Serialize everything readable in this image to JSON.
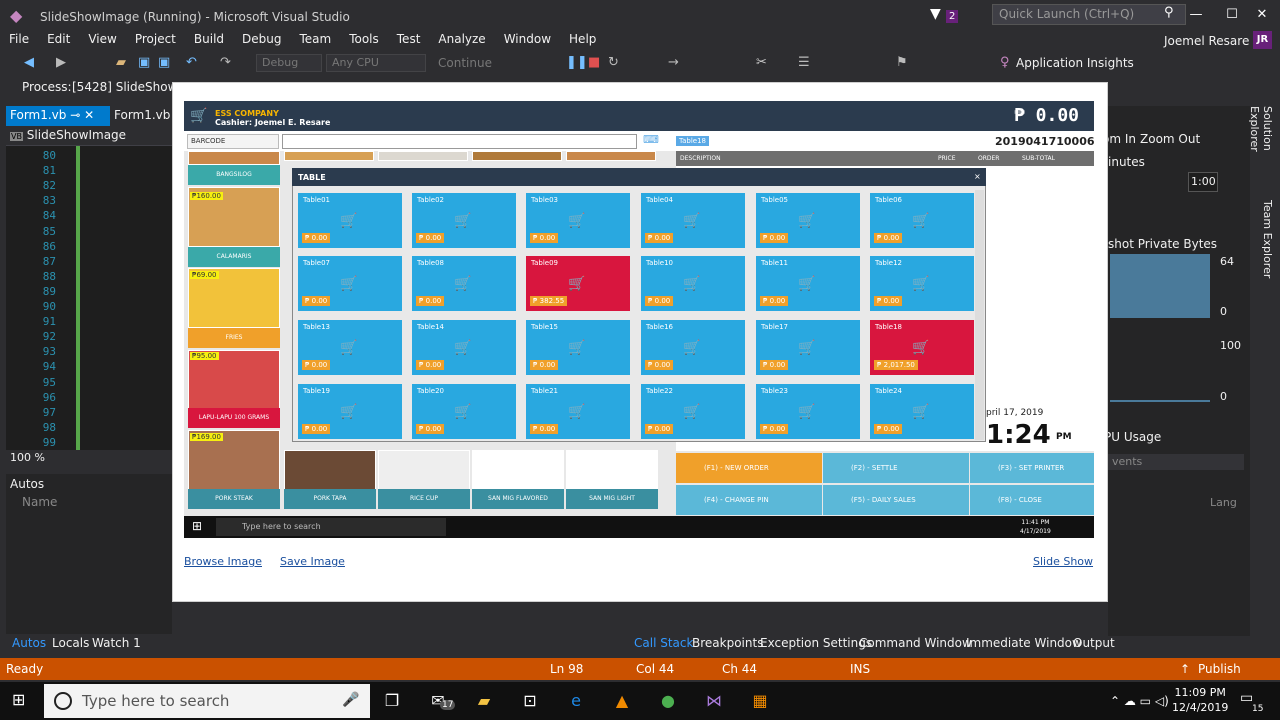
{
  "titlebar": {
    "title": "SlideShowImage (Running) - Microsoft Visual Studio",
    "notif_count": "2",
    "quick_launch": "Quick Launch (Ctrl+Q)",
    "user": "Joemel Resare",
    "avatar": "JR"
  },
  "menu": [
    "File",
    "Edit",
    "View",
    "Project",
    "Build",
    "Debug",
    "Team",
    "Tools",
    "Test",
    "Analyze",
    "Window",
    "Help"
  ],
  "toolbar": {
    "config": "Debug",
    "platform": "Any CPU",
    "continue": "Continue",
    "app_insights": "Application Insights"
  },
  "process": {
    "label": "Process:",
    "value": "[5428] SlideShowIma"
  },
  "editor": {
    "tab1": "Form1.vb",
    "tab2": "Form1.vb [D",
    "class": "SlideShowImage",
    "lines": [
      "80",
      "81",
      "82",
      "83",
      "84",
      "85",
      "86",
      "87",
      "88",
      "89",
      "90",
      "91",
      "92",
      "93",
      "94",
      "95",
      "96",
      "97",
      "98",
      "99"
    ],
    "zoom": "100 %"
  },
  "autos": {
    "title": "Autos",
    "col_name": "Name"
  },
  "bottom_left_tabs": [
    "Autos",
    "Locals",
    "Watch 1"
  ],
  "bottom_right_tabs": [
    "Call Stack",
    "Breakpoints",
    "Exception Settings",
    "Command Window",
    "Immediate Window",
    "Output"
  ],
  "diag": {
    "zoom_in": "om In",
    "zoom_out": "Zoom Out",
    "minutes": "inutes",
    "time": "1:00",
    "legend": "shot  Private Bytes",
    "v64": "64",
    "v0a": "0",
    "v100": "100",
    "v0b": "0",
    "cpu": "PU Usage",
    "events": "vents",
    "lang": "Lang"
  },
  "side_tabs": [
    "Solution Explorer",
    "Team Explorer"
  ],
  "status": {
    "ready": "Ready",
    "ln": "Ln 98",
    "col": "Col 44",
    "ch": "Ch 44",
    "ins": "INS",
    "publish": "Publish"
  },
  "taskbar": {
    "search": "Type here to search",
    "time": "11:09 PM",
    "date": "12/4/2019",
    "mail_badge": "17",
    "notif_badge": "15"
  },
  "pos": {
    "company": "ESS COMPANY",
    "cashier": "Cashier: Joemel E. Resare",
    "total": "₱ 0.00",
    "barcode": "BARCODE",
    "table_tag": "Table18",
    "order_no": "2019041710006",
    "order_headers": [
      "DESCRIPTION",
      "PRICE",
      "ORDER",
      "SUB-TOTAL"
    ],
    "dialog_title": "TABLE",
    "tables": [
      {
        "name": "Table01",
        "amount": "₱ 0.00",
        "busy": false
      },
      {
        "name": "Table02",
        "amount": "₱ 0.00",
        "busy": false
      },
      {
        "name": "Table03",
        "amount": "₱ 0.00",
        "busy": false
      },
      {
        "name": "Table04",
        "amount": "₱ 0.00",
        "busy": false
      },
      {
        "name": "Table05",
        "amount": "₱ 0.00",
        "busy": false
      },
      {
        "name": "Table06",
        "amount": "₱ 0.00",
        "busy": false
      },
      {
        "name": "Table07",
        "amount": "₱ 0.00",
        "busy": false
      },
      {
        "name": "Table08",
        "amount": "₱ 0.00",
        "busy": false
      },
      {
        "name": "Table09",
        "amount": "₱ 382.55",
        "busy": true
      },
      {
        "name": "Table10",
        "amount": "₱ 0.00",
        "busy": false
      },
      {
        "name": "Table11",
        "amount": "₱ 0.00",
        "busy": false
      },
      {
        "name": "Table12",
        "amount": "₱ 0.00",
        "busy": false
      },
      {
        "name": "Table13",
        "amount": "₱ 0.00",
        "busy": false
      },
      {
        "name": "Table14",
        "amount": "₱ 0.00",
        "busy": false
      },
      {
        "name": "Table15",
        "amount": "₱ 0.00",
        "busy": false
      },
      {
        "name": "Table16",
        "amount": "₱ 0.00",
        "busy": false
      },
      {
        "name": "Table17",
        "amount": "₱ 0.00",
        "busy": false
      },
      {
        "name": "Table18",
        "amount": "₱ 2,017.50",
        "busy": true
      },
      {
        "name": "Table19",
        "amount": "₱ 0.00",
        "busy": false
      },
      {
        "name": "Table20",
        "amount": "₱ 0.00",
        "busy": false
      },
      {
        "name": "Table21",
        "amount": "₱ 0.00",
        "busy": false
      },
      {
        "name": "Table22",
        "amount": "₱ 0.00",
        "busy": false
      },
      {
        "name": "Table23",
        "amount": "₱ 0.00",
        "busy": false
      },
      {
        "name": "Table24",
        "amount": "₱ 0.00",
        "busy": false
      }
    ],
    "foods_left": [
      {
        "label": "BANGSILOG",
        "price": ""
      },
      {
        "label": "CALAMARIS",
        "price": "₱160.00"
      },
      {
        "label": "FRIES",
        "price": "₱69.00"
      },
      {
        "label": "LAPU-LAPU 100 GRAMS",
        "price": "₱95.00"
      }
    ],
    "foods_bottom": [
      "PORK STEAK",
      "PORK TAPA",
      "RICE CUP",
      "SAN MIG FLAVORED",
      "SAN MIG LIGHT"
    ],
    "bottom_price": "₱169.00",
    "date": "pril 17, 2019",
    "time": "1:24",
    "ampm": "PM",
    "fkeys": [
      "(F1) - NEW ORDER",
      "(F2) - SETTLE",
      "(F3) - SET PRINTER",
      "(F4) - CHANGE PIN",
      "(F5) - DAILY SALES",
      "(F8) - CLOSE"
    ],
    "win_search": "Type here to search",
    "win_time": "11:41 PM",
    "win_date": "4/17/2019"
  },
  "form": {
    "browse": "Browse Image",
    "save": "Save Image",
    "slideshow": "Slide Show"
  },
  "colors": {
    "accent": "#007acc",
    "status": "#ca5100",
    "table_free": "#29a8e0",
    "table_busy": "#d8163e"
  }
}
